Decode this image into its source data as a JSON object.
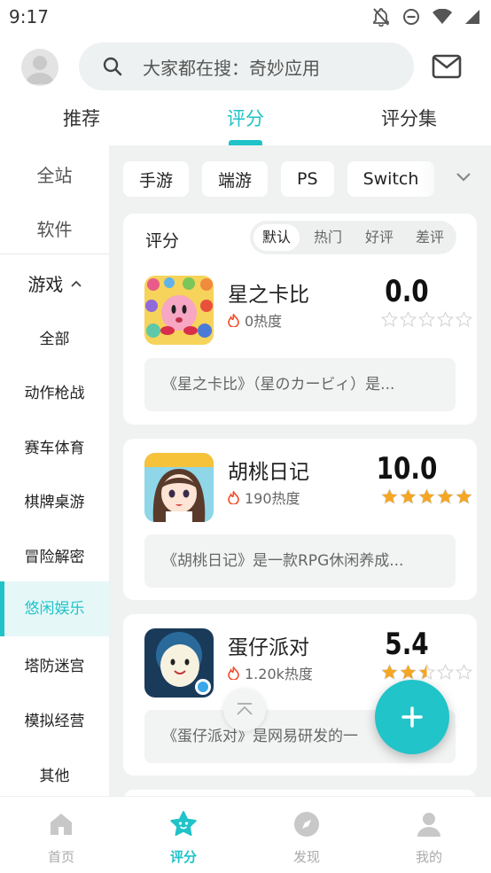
{
  "status_bar": {
    "time": "9:17"
  },
  "search": {
    "placeholder": "大家都在搜：奇妙应用"
  },
  "top_tabs": [
    {
      "label": "推荐",
      "active": false
    },
    {
      "label": "评分",
      "active": true
    },
    {
      "label": "评分集",
      "active": false
    }
  ],
  "sidebar": {
    "top_items": [
      "全站",
      "软件"
    ],
    "game_label": "游戏",
    "categories": [
      "全部",
      "动作枪战",
      "赛车体育",
      "棋牌桌游",
      "冒险解密",
      "悠闲娱乐",
      "塔防迷宫",
      "模拟经营",
      "其他"
    ],
    "active_category": "悠闲娱乐"
  },
  "platform_chips": [
    "手游",
    "端游",
    "PS",
    "Switch"
  ],
  "rating_card": {
    "title": "评分",
    "sort_options": [
      "默认",
      "热门",
      "好评",
      "差评"
    ],
    "active_sort": "默认"
  },
  "games": [
    {
      "name": "星之卡比",
      "heat": "0热度",
      "score": "0.0",
      "stars": 0,
      "description": "《星之卡比》（星のカービィ）是..."
    },
    {
      "name": "胡桃日记",
      "heat": "190热度",
      "score": "10.0",
      "stars": 5,
      "description": "《胡桃日记》是一款RPG休闲养成..."
    },
    {
      "name": "蛋仔派对",
      "heat": "1.20k热度",
      "score": "5.4",
      "stars": 2.5,
      "description": "《蛋仔派对》是网易研发的一"
    }
  ],
  "bottom_nav": [
    {
      "label": "首页",
      "icon": "home-icon",
      "active": false
    },
    {
      "label": "评分",
      "icon": "star-face-icon",
      "active": true
    },
    {
      "label": "发现",
      "icon": "compass-icon",
      "active": false
    },
    {
      "label": "我的",
      "icon": "person-icon",
      "active": false
    }
  ],
  "colors": {
    "accent": "#1fc3c8",
    "star": "#f5a623",
    "background": "#f0f2f2"
  }
}
